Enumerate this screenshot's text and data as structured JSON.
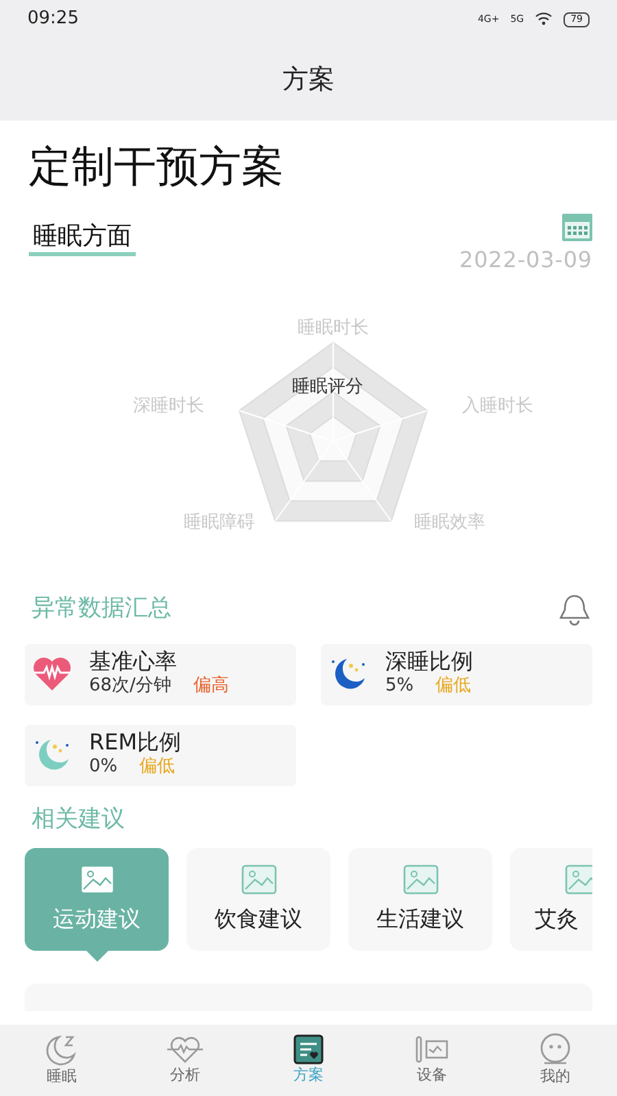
{
  "status_bar": {
    "time": "09:25",
    "network_1": "4G+",
    "network_2": "5G",
    "battery": "79"
  },
  "header": {
    "title": "方案"
  },
  "page_title": "定制干预方案",
  "section": {
    "label": "睡眠方面",
    "date": "2022-03-09"
  },
  "radar": {
    "center_label": "睡眠评分",
    "axes": [
      "睡眠时长",
      "入睡时长",
      "睡眠效率",
      "睡眠障碍",
      "深睡时长"
    ]
  },
  "abnormal": {
    "title": "异常数据汇总",
    "items": [
      {
        "kind": "heart",
        "name": "基准心率",
        "value": "68次/分钟",
        "flag": "偏高",
        "color": "#e8622c"
      },
      {
        "kind": "moon-blue",
        "name": "深睡比例",
        "value": "5%",
        "flag": "偏低",
        "color": "#e8a820"
      },
      {
        "kind": "moon-teal",
        "name": "REM比例",
        "value": "0%",
        "flag": "偏低",
        "color": "#e8a820"
      }
    ]
  },
  "suggestions": {
    "title": "相关建议",
    "items": [
      {
        "label": "运动建议",
        "selected": true
      },
      {
        "label": "饮食建议",
        "selected": false
      },
      {
        "label": "生活建议",
        "selected": false
      },
      {
        "label": "艾灸",
        "selected": false
      }
    ]
  },
  "nav": [
    {
      "kind": "sleep",
      "label": "睡眠",
      "selected": false
    },
    {
      "kind": "analysis",
      "label": "分析",
      "selected": false
    },
    {
      "kind": "plan",
      "label": "方案",
      "selected": true
    },
    {
      "kind": "device",
      "label": "设备",
      "selected": false
    },
    {
      "kind": "me",
      "label": "我的",
      "selected": false
    }
  ]
}
